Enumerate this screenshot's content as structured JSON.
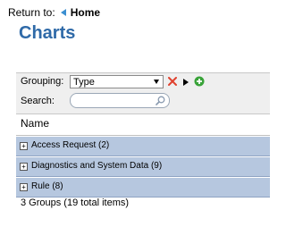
{
  "nav": {
    "return_label": "Return to:",
    "home_label": "Home"
  },
  "page": {
    "title": "Charts"
  },
  "toolbar": {
    "grouping_label": "Grouping:",
    "grouping_value": "Type",
    "search_label": "Search:",
    "search_value": "",
    "search_placeholder": ""
  },
  "table": {
    "column_header": "Name",
    "groups": [
      {
        "label": "Access Request (2)"
      },
      {
        "label": "Diagnostics and System Data (9)"
      },
      {
        "label": "Rule (8)"
      }
    ],
    "summary": "3 Groups (19 total items)"
  },
  "colors": {
    "title": "#2f6aa8",
    "group_row": "#b6c7df",
    "toolbar_bg": "#efefef",
    "accent_arrow": "#3b8fd1"
  },
  "icons": [
    "home-arrow-icon",
    "caret-down-icon",
    "remove-x-icon",
    "play-icon",
    "add-icon",
    "search-icon",
    "expand-plus-icon"
  ]
}
